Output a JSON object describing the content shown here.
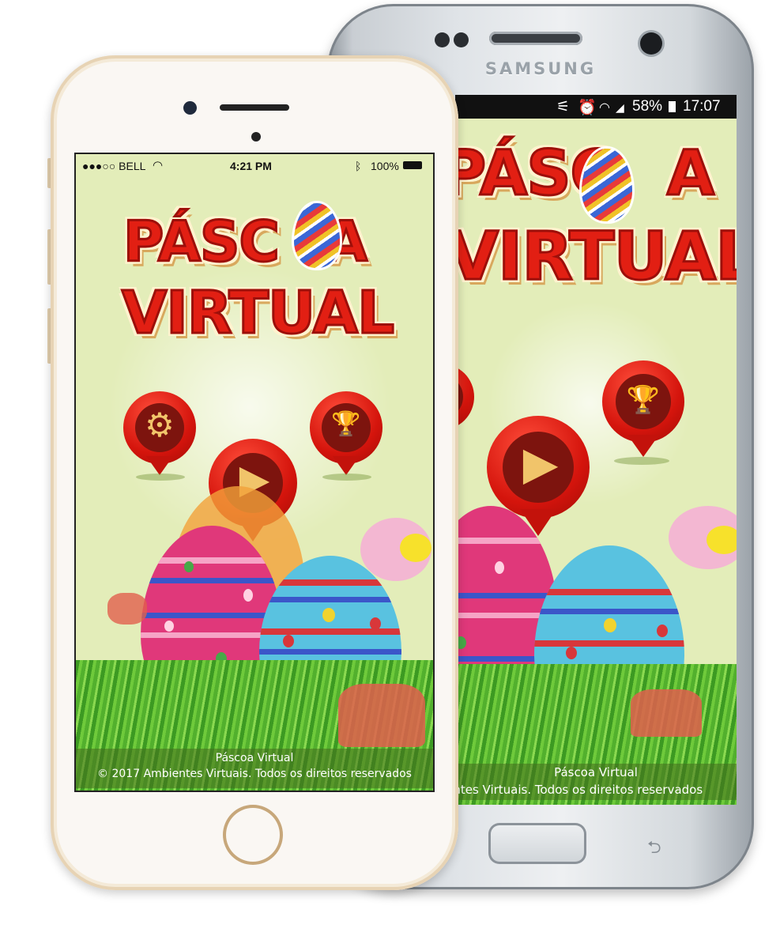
{
  "samsung": {
    "brand": "SAMSUNG",
    "status": {
      "battery": "58%",
      "time": "17:07"
    },
    "app": {
      "title_line1": "PÁSC",
      "title_line1_end": "A",
      "title_line2": "VIRTUAL",
      "footer_title": "Páscoa Virtual",
      "footer_copyright": "© 2017 Ambientes Virtuais. Todos os direitos reservados"
    }
  },
  "iphone": {
    "status": {
      "carrier": "●●●○○ BELL",
      "time": "4:21 PM",
      "battery": "100%"
    },
    "app": {
      "title_line1": "PÁSC",
      "title_line1_end": "A",
      "title_line2": "VIRTUAL",
      "footer_title": "Páscoa Virtual",
      "footer_copyright": "© 2017 Ambientes Virtuais. Todos os direitos reservados"
    }
  },
  "icons": {
    "settings": "⚙",
    "trophy": "🏆",
    "play": "▶",
    "wifi": "wifi-icon",
    "bluetooth": "bluetooth-icon"
  },
  "colors": {
    "title_red": "#e21f13",
    "pin_red": "#d4140c",
    "background": "#e3edb9",
    "grass": "#52b02d"
  }
}
